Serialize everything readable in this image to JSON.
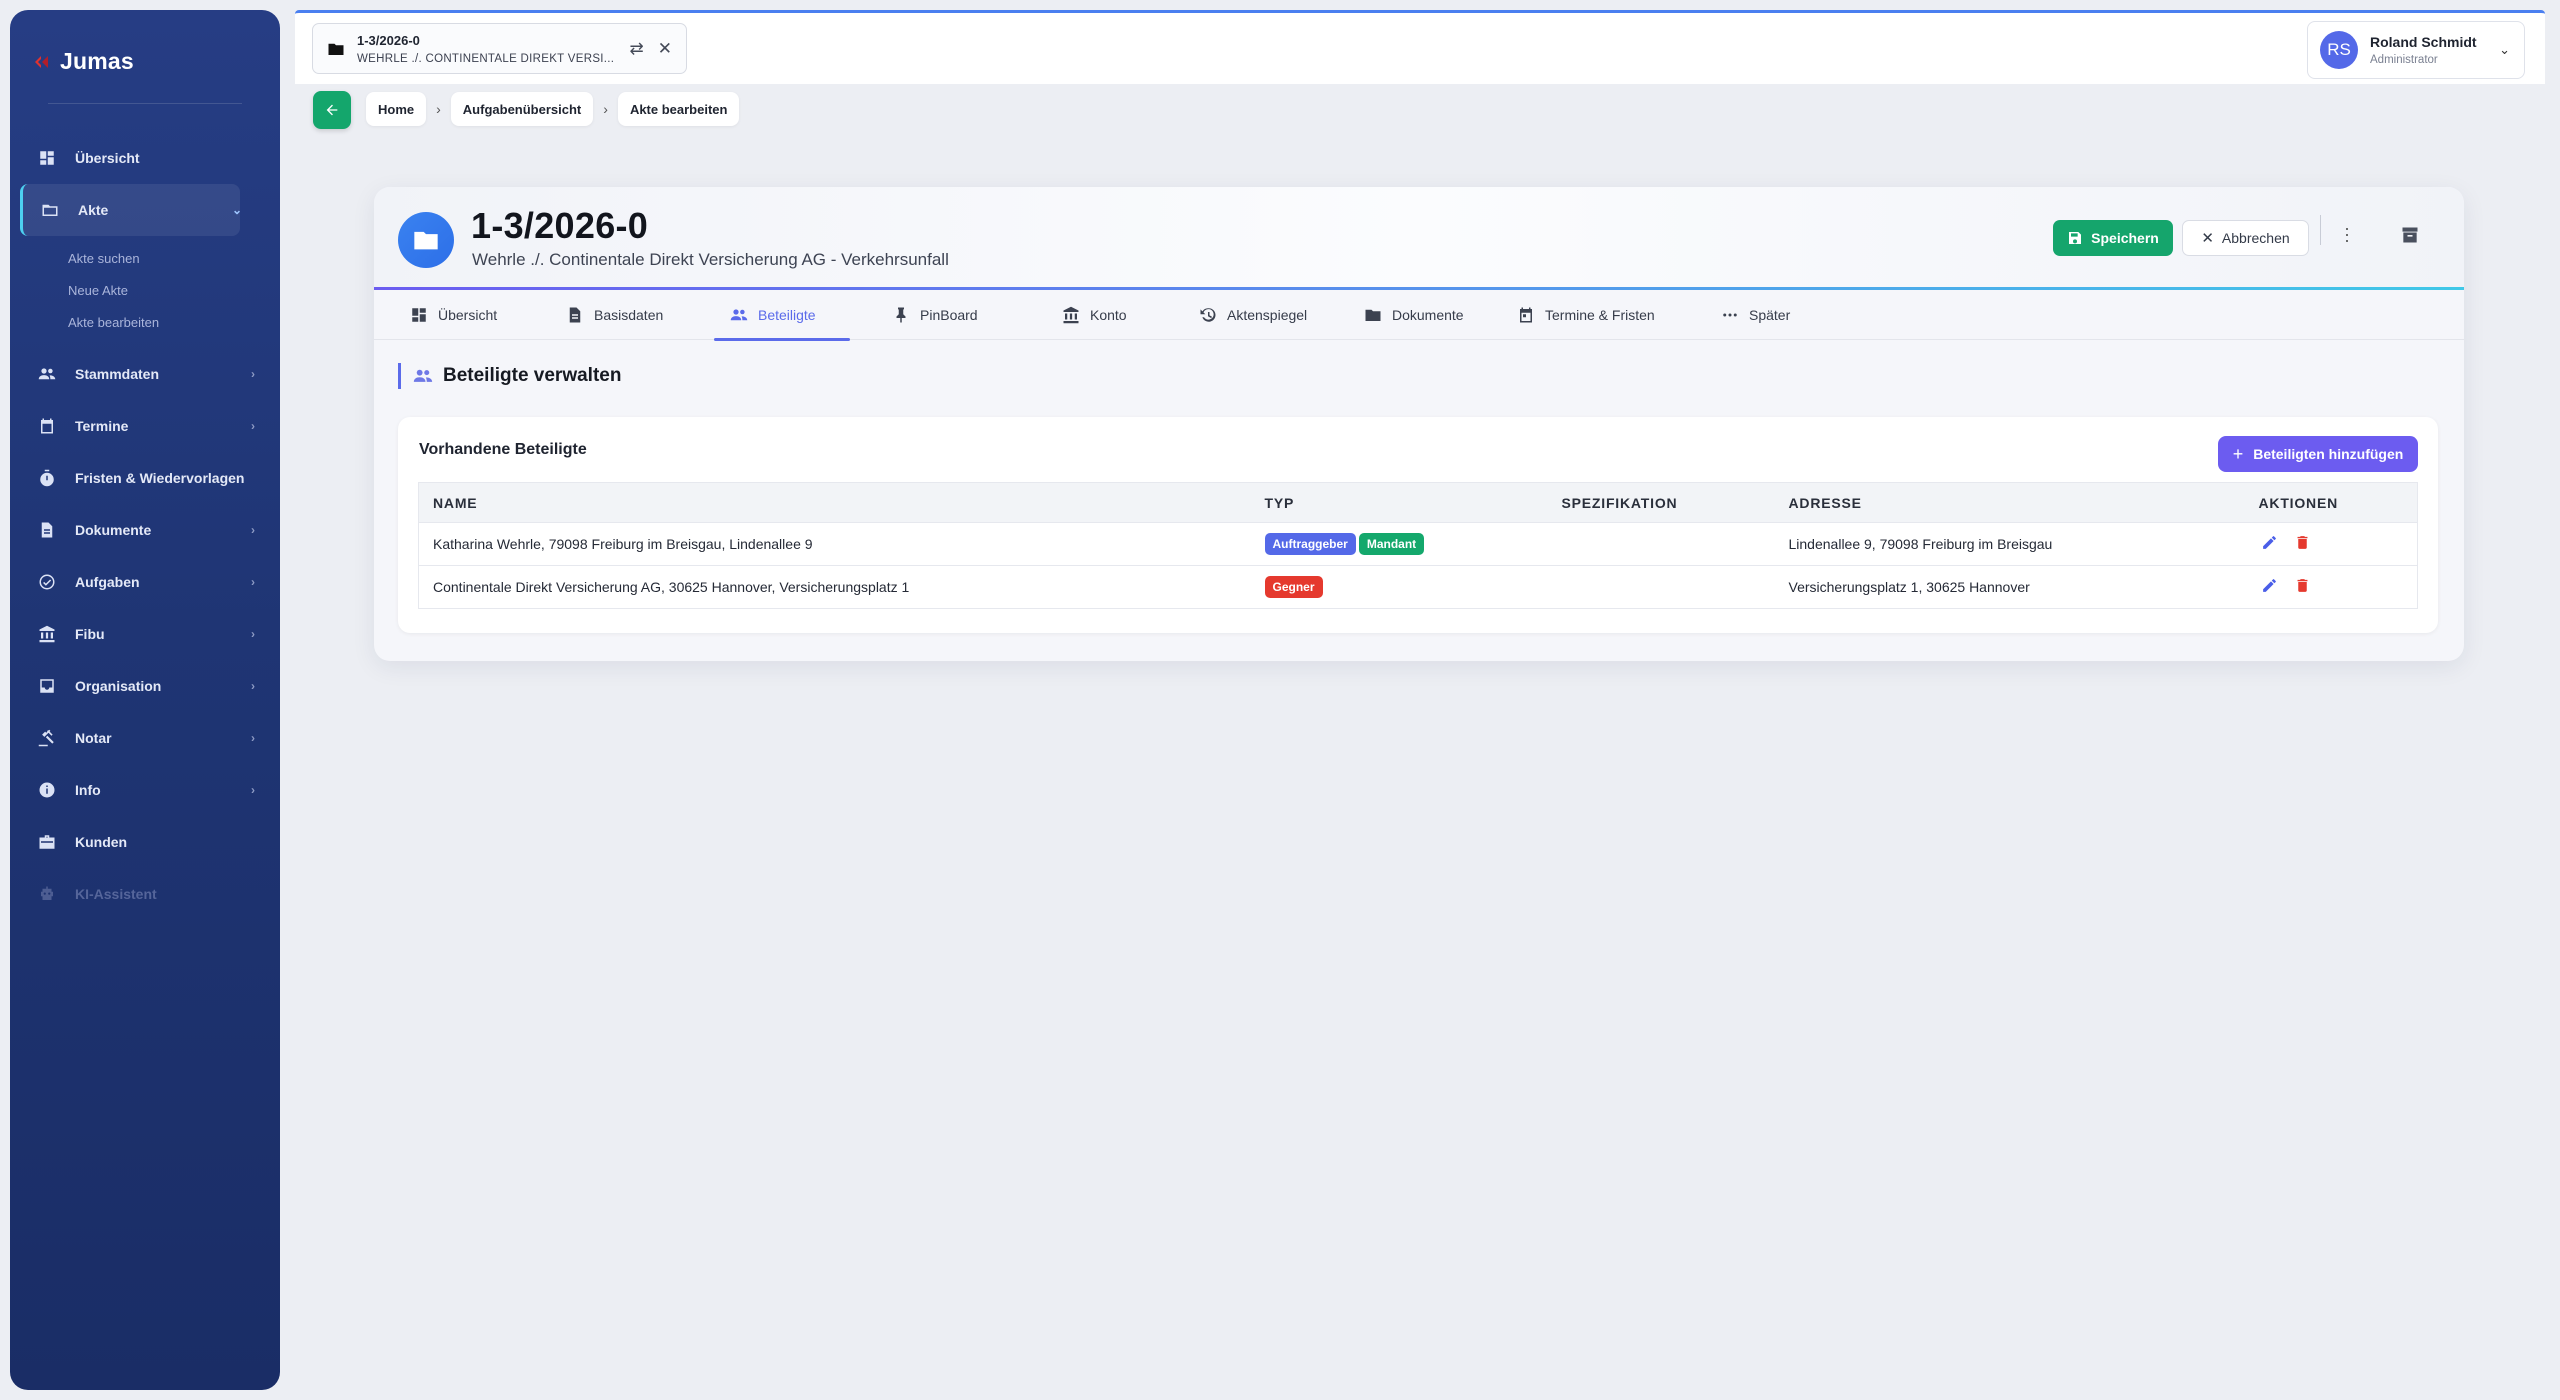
{
  "app": {
    "name": "Jumas"
  },
  "sidebar": {
    "items": [
      {
        "label": "Übersicht",
        "icon": "dashboard-icon"
      },
      {
        "label": "Akte",
        "icon": "folder-icon",
        "active": true
      },
      {
        "label": "Stammdaten",
        "icon": "people-icon"
      },
      {
        "label": "Termine",
        "icon": "calendar-icon"
      },
      {
        "label": "Fristen & Wiedervorlagen",
        "icon": "timer-icon"
      },
      {
        "label": "Dokumente",
        "icon": "document-icon"
      },
      {
        "label": "Aufgaben",
        "icon": "check-circle-icon"
      },
      {
        "label": "Fibu",
        "icon": "bank-icon"
      },
      {
        "label": "Organisation",
        "icon": "inbox-icon"
      },
      {
        "label": "Notar",
        "icon": "gavel-icon"
      },
      {
        "label": "Info",
        "icon": "info-icon"
      },
      {
        "label": "Kunden",
        "icon": "briefcase-icon"
      },
      {
        "label": "KI-Assistent",
        "icon": "robot-icon",
        "disabled": true
      }
    ],
    "akte_sub": [
      "Akte suchen",
      "Neue Akte",
      "Akte bearbeiten"
    ]
  },
  "topbar": {
    "file_tab": {
      "title": "1-3/2026-0",
      "subtitle": "WEHRLE ./. CONTINENTALE DIREKT VERSI..."
    },
    "user": {
      "initials": "RS",
      "name": "Roland Schmidt",
      "role": "Administrator"
    }
  },
  "breadcrumb": [
    "Home",
    "Aufgabenübersicht",
    "Akte bearbeiten"
  ],
  "akte": {
    "number": "1-3/2026-0",
    "subtitle": "Wehrle ./. Continentale Direkt Versicherung AG - Verkehrsunfall",
    "save_label": "Speichern",
    "cancel_label": "Abbrechen"
  },
  "tabs": [
    {
      "label": "Übersicht",
      "icon": "dashboard-icon"
    },
    {
      "label": "Basisdaten",
      "icon": "document-icon"
    },
    {
      "label": "Beteiligte",
      "icon": "people-icon",
      "active": true
    },
    {
      "label": "PinBoard",
      "icon": "pin-icon"
    },
    {
      "label": "Konto",
      "icon": "bank-icon"
    },
    {
      "label": "Aktenspiegel",
      "icon": "history-icon"
    },
    {
      "label": "Dokumente",
      "icon": "folder-icon"
    },
    {
      "label": "Termine & Fristen",
      "icon": "calendar-icon"
    },
    {
      "label": "Später",
      "icon": "more-horiz-icon"
    }
  ],
  "section": {
    "title": "Beteiligte verwalten"
  },
  "panel": {
    "title": "Vorhandene Beteiligte",
    "add_label": "Beteiligten hinzufügen",
    "columns": [
      "NAME",
      "TYP",
      "SPEZIFIKATION",
      "ADRESSE",
      "AKTIONEN"
    ],
    "rows": [
      {
        "name": "Katharina Wehrle, 79098 Freiburg im Breisgau, Lindenallee 9",
        "types": [
          {
            "label": "Auftraggeber",
            "color": "#5469e8"
          },
          {
            "label": "Mandant",
            "color": "#14a86c"
          }
        ],
        "spezifikation": "",
        "adresse": "Lindenallee 9, 79098 Freiburg im Breisgau"
      },
      {
        "name": "Continentale Direkt Versicherung AG, 30625 Hannover, Versicherungsplatz 1",
        "types": [
          {
            "label": "Gegner",
            "color": "#e5392e"
          }
        ],
        "spezifikation": "",
        "adresse": "Versicherungsplatz 1, 30625 Hannover"
      }
    ]
  }
}
